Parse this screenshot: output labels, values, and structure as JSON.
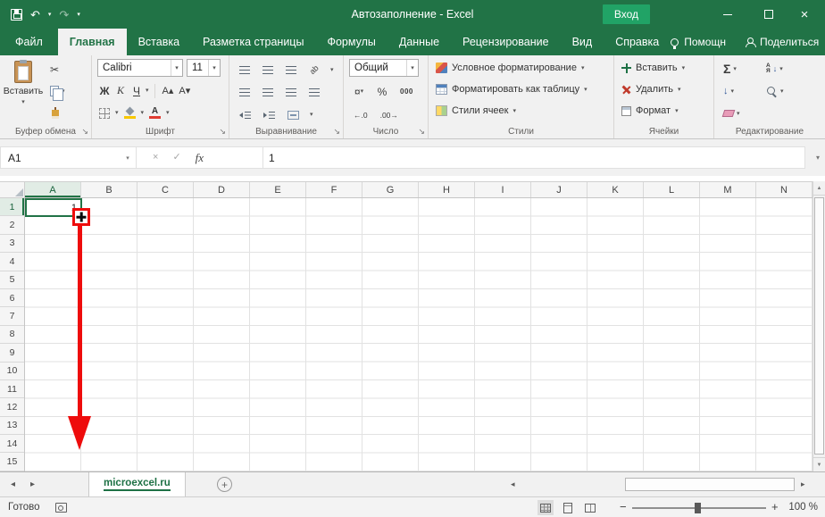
{
  "colors": {
    "excel_green": "#217346",
    "sign_in_green": "#21a366",
    "ribbon_bg": "#f1f1f1",
    "annotation_red": "#ee0c0c",
    "fill_yellow": "#f7c700",
    "font_color_red": "#e03c32"
  },
  "title_bar": {
    "title": "Автозаполнение - Excel",
    "sign_in": "Вход"
  },
  "tab_row": {
    "file": "Файл",
    "tabs": [
      "Главная",
      "Вставка",
      "Разметка страницы",
      "Формулы",
      "Данные",
      "Рецензирование",
      "Вид",
      "Справка"
    ],
    "active_tab": "Главная",
    "assistant": "Помощн",
    "share": "Поделиться"
  },
  "ribbon": {
    "clipboard": {
      "label": "Буфер обмена",
      "paste": "Вставить"
    },
    "font": {
      "label": "Шрифт",
      "family": "Calibri",
      "size": "11"
    },
    "alignment": {
      "label": "Выравнивание"
    },
    "number": {
      "label": "Число",
      "format": "Общий"
    },
    "styles": {
      "label": "Стили",
      "conditional_formatting": "Условное форматирование",
      "format_as_table": "Форматировать как таблицу",
      "cell_styles": "Стили ячеек"
    },
    "cells": {
      "label": "Ячейки",
      "insert": "Вставить",
      "delete": "Удалить",
      "format": "Формат"
    },
    "editing": {
      "label": "Редактирование"
    }
  },
  "formula_bar": {
    "name_box": "A1",
    "fx": "fx",
    "value": "1"
  },
  "grid": {
    "columns": [
      "A",
      "B",
      "C",
      "D",
      "E",
      "F",
      "G",
      "H",
      "I",
      "J",
      "K",
      "L",
      "M",
      "N"
    ],
    "rows": [
      "1",
      "2",
      "3",
      "4",
      "5",
      "6",
      "7",
      "8",
      "9",
      "10",
      "11",
      "12",
      "13",
      "14",
      "15"
    ],
    "selected_column": "A",
    "selected_row": "1",
    "selected_cell": "A1",
    "selected_cell_value": "1"
  },
  "sheet_bar": {
    "active_sheet": "microexcel.ru"
  },
  "status_bar": {
    "mode": "Готово",
    "zoom": "100 %"
  },
  "icons": {
    "undo": "↶",
    "redo": "↷",
    "dropdown": "▾",
    "close": "×",
    "cut": "✂",
    "bold": "Ж",
    "italic": "К",
    "underline": "Ч",
    "grow_font": "А▴",
    "shrink_font": "А▾",
    "font_color_letter": "А",
    "orientation_text": "ab",
    "currency": "¤",
    "percent": "%",
    "thousands": "000",
    "decimal_increase": "←.0",
    "decimal_decrease": ".00→",
    "autosum": "Σ",
    "sort_top": "А",
    "sort_bottom": "Я",
    "sort_arrow": "↓",
    "fill_down": "↓",
    "cancel": "×",
    "enter": "✓",
    "prev": "◂",
    "next": "▸",
    "up": "▲",
    "down": "▼",
    "new_sheet": "+",
    "zoom_minus": "−",
    "zoom_plus": "+",
    "launcher": "↘"
  }
}
